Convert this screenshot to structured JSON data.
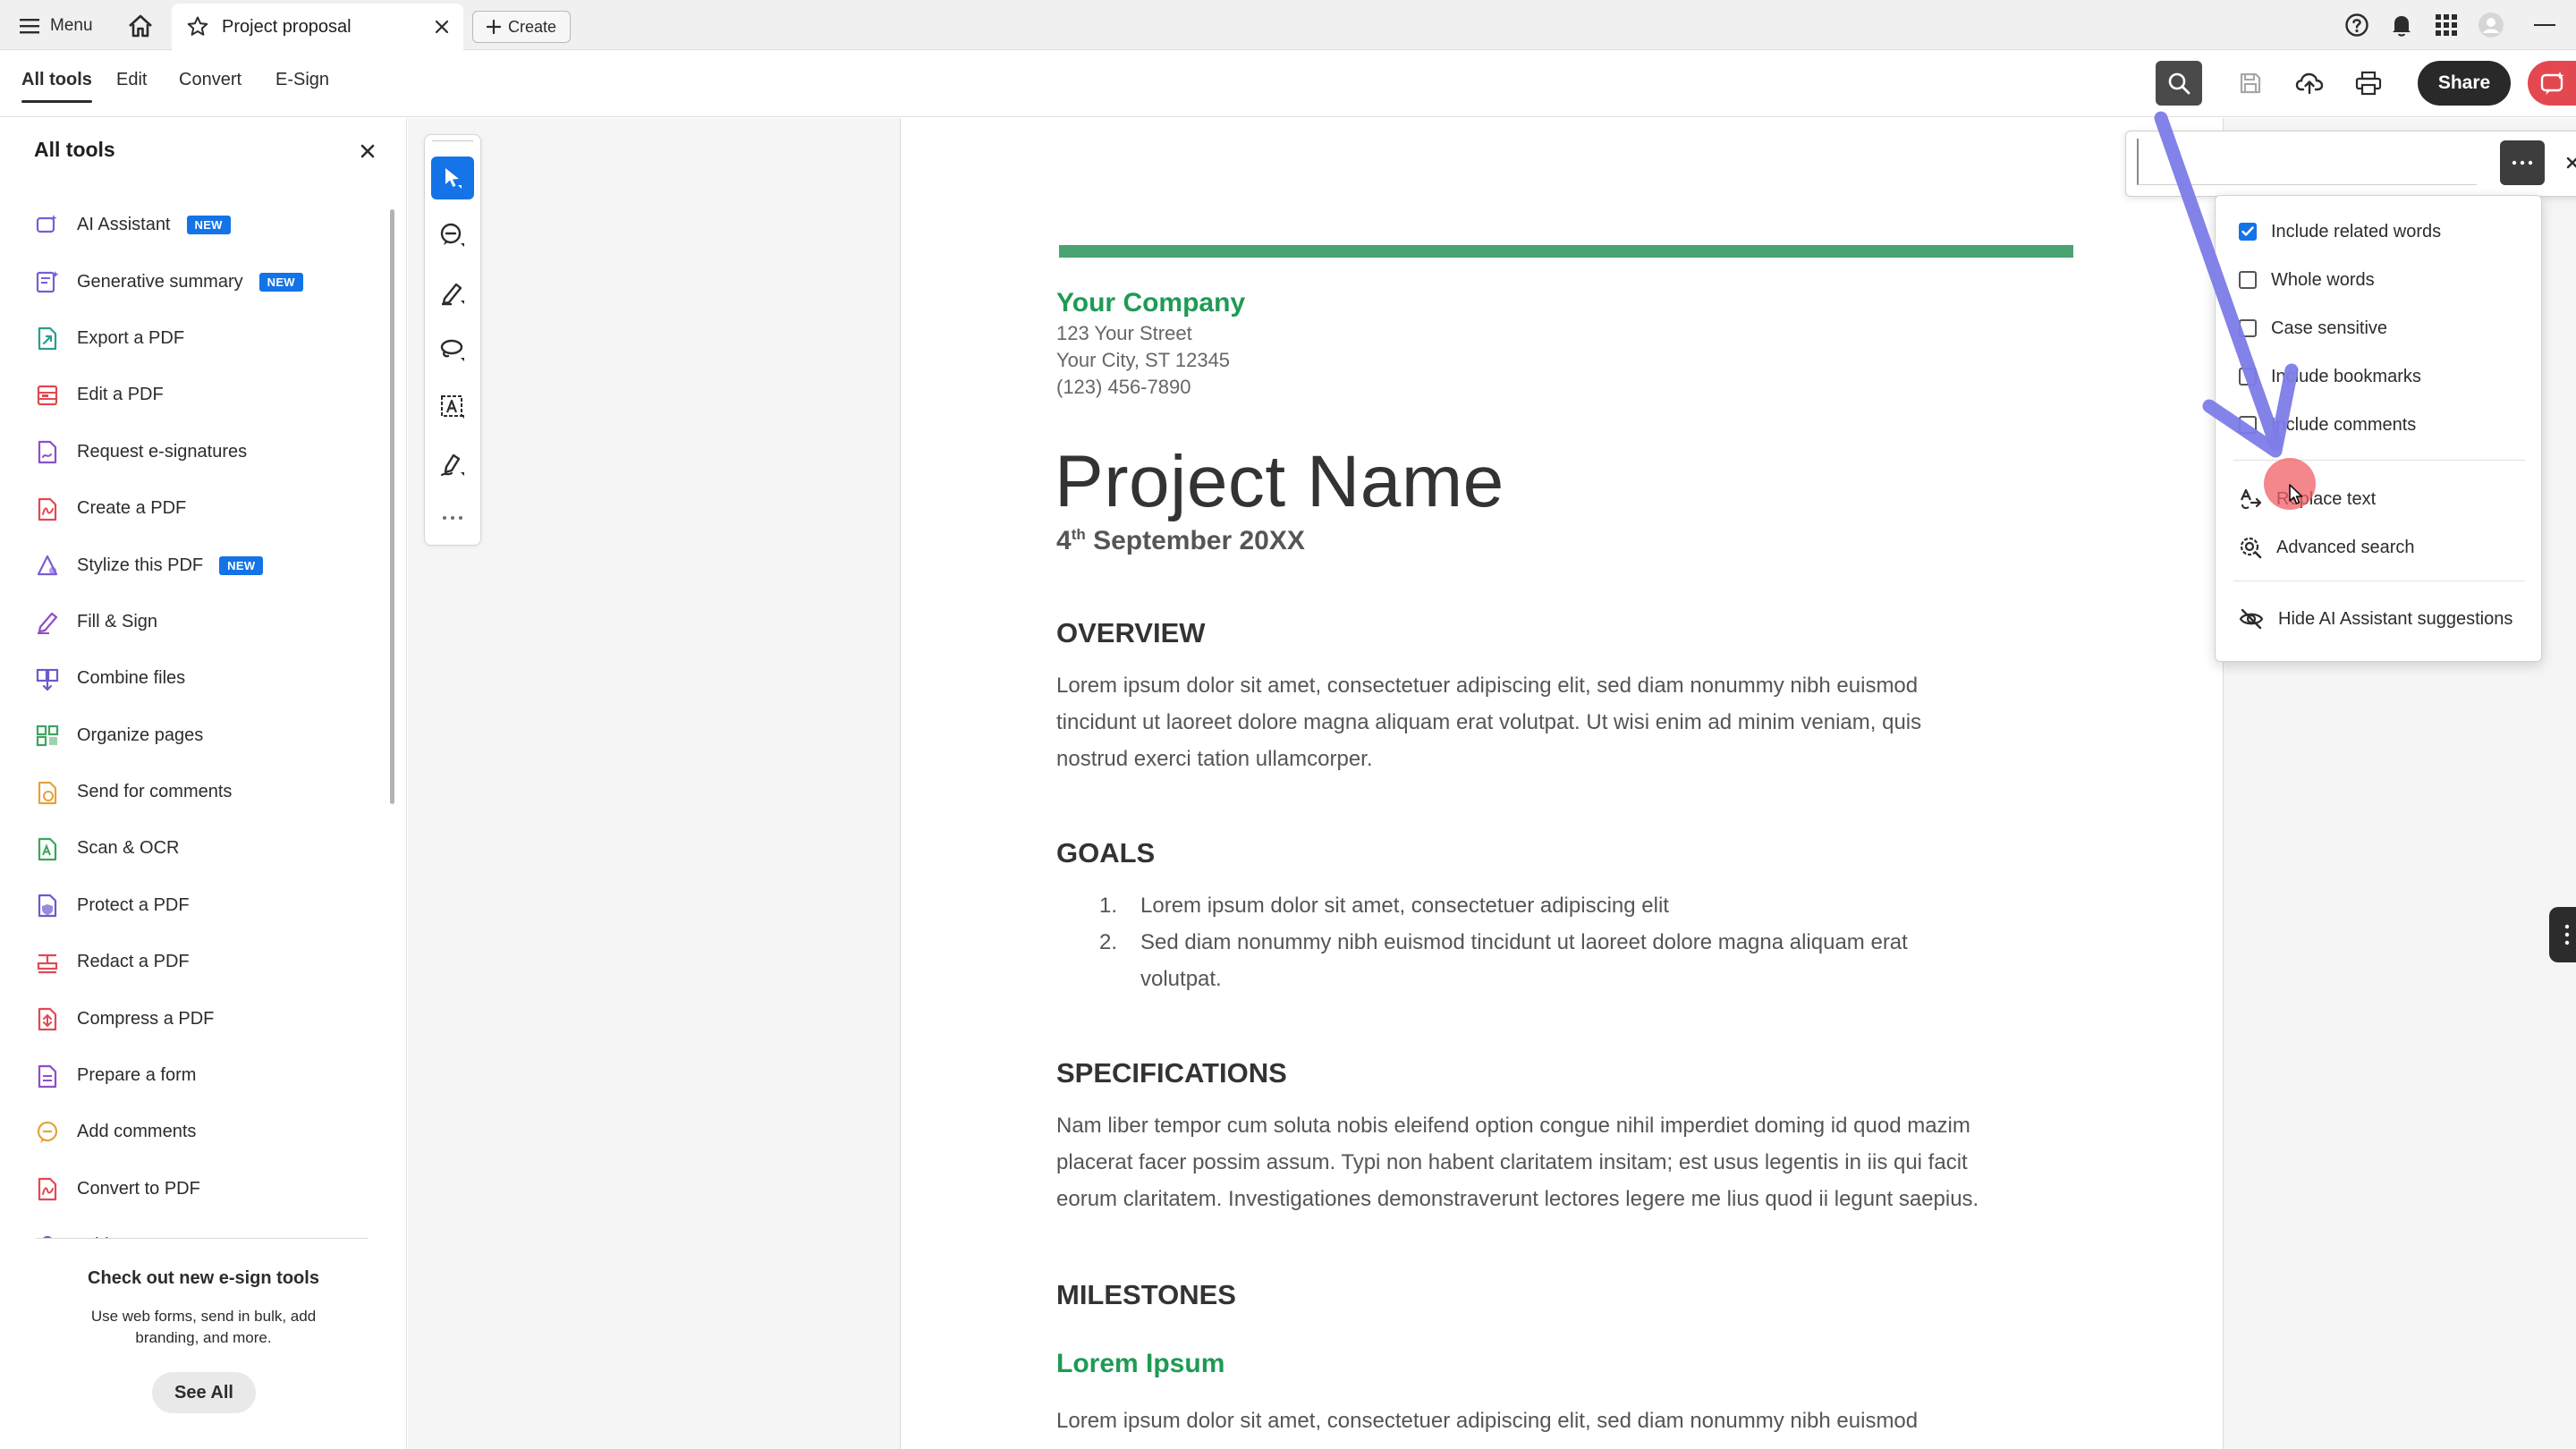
{
  "topbar": {
    "menu_label": "Menu",
    "tab_title": "Project proposal",
    "create_label": "Create"
  },
  "toolbar": {
    "tabs": [
      {
        "label": "All tools",
        "active": true
      },
      {
        "label": "Edit",
        "active": false
      },
      {
        "label": "Convert",
        "active": false
      },
      {
        "label": "E-Sign",
        "active": false
      }
    ],
    "share_label": "Share"
  },
  "left_panel": {
    "title": "All tools",
    "items": [
      {
        "label": "AI Assistant",
        "badge": "NEW",
        "icon": "ai-assistant-icon",
        "color": "#7b5cd6"
      },
      {
        "label": "Generative summary",
        "badge": "NEW",
        "icon": "generative-summary-icon",
        "color": "#7b5cd6"
      },
      {
        "label": "Export a PDF",
        "badge": "",
        "icon": "export-pdf-icon",
        "color": "#2a9d8f"
      },
      {
        "label": "Edit a PDF",
        "badge": "",
        "icon": "edit-pdf-icon",
        "color": "#e34850"
      },
      {
        "label": "Request e-signatures",
        "badge": "",
        "icon": "request-esign-icon",
        "color": "#8e4ec6"
      },
      {
        "label": "Create a PDF",
        "badge": "",
        "icon": "create-pdf-icon",
        "color": "#e34850"
      },
      {
        "label": "Stylize this PDF",
        "badge": "NEW",
        "icon": "stylize-pdf-icon",
        "color": "#7b5cd6"
      },
      {
        "label": "Fill & Sign",
        "badge": "",
        "icon": "fill-sign-icon",
        "color": "#8e4ec6"
      },
      {
        "label": "Combine files",
        "badge": "",
        "icon": "combine-files-icon",
        "color": "#6a5acd"
      },
      {
        "label": "Organize pages",
        "badge": "",
        "icon": "organize-pages-icon",
        "color": "#3ba55c"
      },
      {
        "label": "Send for comments",
        "badge": "",
        "icon": "send-comments-icon",
        "color": "#e6a23c"
      },
      {
        "label": "Scan & OCR",
        "badge": "",
        "icon": "scan-ocr-icon",
        "color": "#3ba55c"
      },
      {
        "label": "Protect a PDF",
        "badge": "",
        "icon": "protect-pdf-icon",
        "color": "#6a5acd"
      },
      {
        "label": "Redact a PDF",
        "badge": "",
        "icon": "redact-pdf-icon",
        "color": "#e34850"
      },
      {
        "label": "Compress a PDF",
        "badge": "",
        "icon": "compress-pdf-icon",
        "color": "#e34850"
      },
      {
        "label": "Prepare a form",
        "badge": "",
        "icon": "prepare-form-icon",
        "color": "#8e4ec6"
      },
      {
        "label": "Add comments",
        "badge": "",
        "icon": "add-comments-icon",
        "color": "#e6a23c"
      },
      {
        "label": "Convert to PDF",
        "badge": "",
        "icon": "convert-pdf-icon",
        "color": "#e34850"
      },
      {
        "label": "Add a stamp",
        "badge": "",
        "icon": "stamp-icon",
        "color": "#6a5acd"
      }
    ],
    "promo": {
      "title": "Check out new e-sign tools",
      "text": "Use web forms, send in bulk, add branding, and more.",
      "button": "See All"
    }
  },
  "document": {
    "company": "Your Company",
    "address_lines": [
      "123 Your Street",
      "Your City, ST 12345",
      "(123) 456-7890"
    ],
    "title": "Project Name",
    "date_day": "4",
    "date_suffix": "th",
    "date_rest": " September 20XX",
    "overview_heading": "OVERVIEW",
    "overview_lines": [
      "Lorem ipsum dolor sit amet, consectetuer adipiscing elit, sed diam nonummy nibh euismod",
      "tincidunt ut laoreet dolore magna aliquam erat volutpat. Ut wisi enim ad minim veniam, quis",
      "nostrud exerci tation ullamcorper."
    ],
    "goals_heading": "GOALS",
    "goals": [
      {
        "num": "1.",
        "lines": [
          "Lorem ipsum dolor sit amet, consectetuer adipiscing elit"
        ]
      },
      {
        "num": "2.",
        "lines": [
          "Sed diam nonummy nibh euismod tincidunt ut laoreet dolore magna aliquam erat",
          "volutpat."
        ]
      }
    ],
    "specs_heading": "SPECIFICATIONS",
    "specs_lines": [
      "Nam liber tempor cum soluta nobis eleifend option congue nihil imperdiet doming id quod mazim",
      "placerat facer possim assum. Typi non habent claritatem insitam; est usus legentis in iis qui facit",
      "eorum claritatem. Investigationes demonstraverunt lectores legere me lius quod ii legunt saepius."
    ],
    "milestones_heading": "MILESTONES",
    "milestone_sub": "Lorem Ipsum",
    "milestone_line": "Lorem ipsum dolor sit amet, consectetuer adipiscing elit, sed diam nonummy nibh euismod"
  },
  "search": {
    "value": "",
    "placeholder": ""
  },
  "search_menu": {
    "options": [
      {
        "label": "Include related words",
        "checked": true
      },
      {
        "label": "Whole words",
        "checked": false
      },
      {
        "label": "Case sensitive",
        "checked": false
      },
      {
        "label": "Include bookmarks",
        "checked": false
      },
      {
        "label": "Include comments",
        "checked": false
      }
    ],
    "actions": [
      {
        "label": "Replace text",
        "icon": "replace-text-icon"
      },
      {
        "label": "Advanced search",
        "icon": "advanced-search-icon"
      }
    ],
    "hide_ai": {
      "label": "Hide AI Assistant suggestions",
      "icon": "hide-eye-icon"
    }
  },
  "colors": {
    "accent": "#1473e6",
    "brand_green": "#1f9a55",
    "rule_green": "#4aa373",
    "annotation_arrow": "#7d7ce8",
    "cursor_dot": "#ef5f66"
  }
}
